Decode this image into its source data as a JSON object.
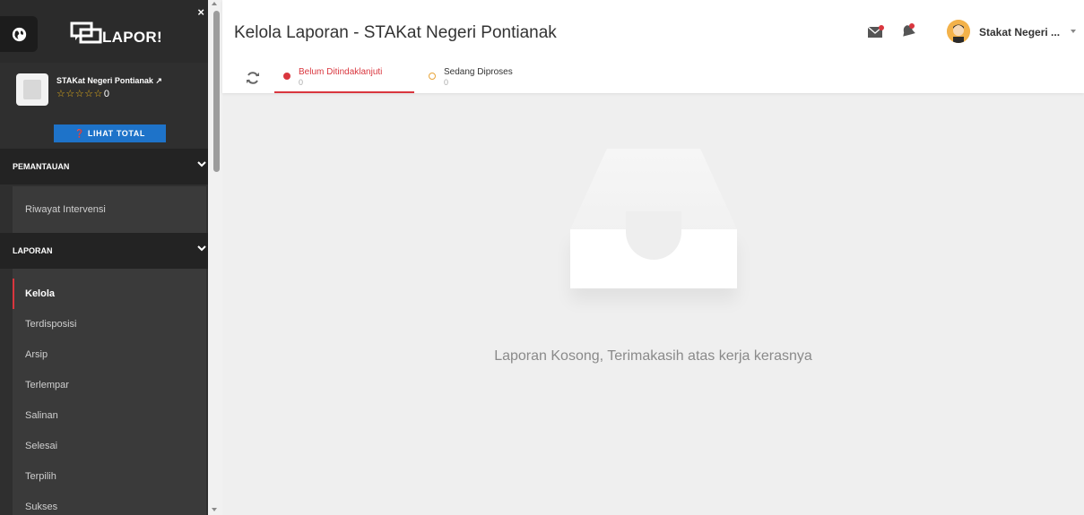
{
  "app": {
    "logo_text": "LAPOR!",
    "close_symbol": "×"
  },
  "profile": {
    "name": "STAKat Negeri Pontianak",
    "external_link_symbol": "↗",
    "stars": "☆☆☆☆☆",
    "rating_count": "0"
  },
  "total_button": "❓ LIHAT TOTAL",
  "sections": {
    "pemantauan": {
      "title": "PEMANTAUAN",
      "items": [
        "Riwayat Intervensi"
      ]
    },
    "laporan": {
      "title": "LAPORAN",
      "items": [
        "Kelola",
        "Terdisposisi",
        "Arsip",
        "Terlempar",
        "Salinan",
        "Selesai",
        "Terpilih",
        "Sukses"
      ],
      "active": "Kelola"
    }
  },
  "header": {
    "title": "Kelola Laporan - STAKat Negeri Pontianak",
    "user_name": "Stakat Negeri ..."
  },
  "tabs": [
    {
      "label": "Belum Ditindaklanjuti",
      "count": "0"
    },
    {
      "label": "Sedang Diproses",
      "count": "0"
    }
  ],
  "empty_state": {
    "message": "Laporan Kosong, Terimakasih atas kerja kerasnya"
  },
  "colors": {
    "sidebar_bg": "#2f2f2f",
    "accent_red": "#d9363e",
    "accent_blue": "#1e73c9",
    "accent_orange": "#e8a53a",
    "star_yellow": "#e9b21a"
  },
  "icons": {
    "sidebar_toggle": "globe-icon",
    "logo": "chat-bubbles-icon",
    "refresh": "refresh-icon",
    "mail": "mail-icon",
    "notification": "bell-icon"
  }
}
